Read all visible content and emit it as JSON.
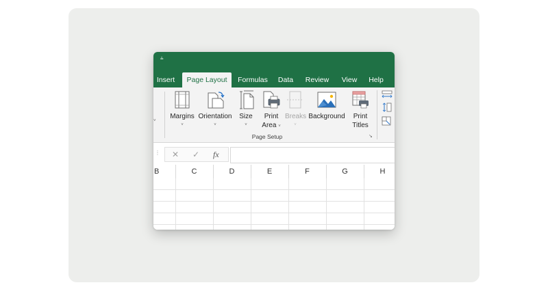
{
  "app": {
    "qat_icon": "customize-quick-access-icon",
    "qat_glyph": "⫨"
  },
  "tabs": [
    {
      "label": "Insert",
      "active": false
    },
    {
      "label": "Page Layout",
      "active": true
    },
    {
      "label": "Formulas",
      "active": false
    },
    {
      "label": "Data",
      "active": false
    },
    {
      "label": "Review",
      "active": false
    },
    {
      "label": "View",
      "active": false
    },
    {
      "label": "Help",
      "active": false
    }
  ],
  "ribbon": {
    "group_label": "Page Setup",
    "launcher_glyph": "↘",
    "buttons": {
      "margins": {
        "label": "Margins",
        "has_dropdown": true,
        "icon": "margins-icon"
      },
      "orientation": {
        "label": "Orientation",
        "has_dropdown": true,
        "icon": "orientation-icon"
      },
      "size": {
        "label": "Size",
        "has_dropdown": true,
        "icon": "size-icon"
      },
      "print_area": {
        "label_line1": "Print",
        "label_line2": "Area",
        "has_dropdown": true,
        "icon": "print-area-icon"
      },
      "breaks": {
        "label": "Breaks",
        "has_dropdown": true,
        "disabled": true,
        "icon": "breaks-icon"
      },
      "background": {
        "label": "Background",
        "icon": "background-icon"
      },
      "print_titles": {
        "label_line1": "Print",
        "label_line2": "Titles",
        "icon": "print-titles-icon"
      }
    },
    "dropdown_glyph": "˅",
    "chevron_glyph": "˅"
  },
  "formula_bar": {
    "cancel_glyph": "✕",
    "enter_glyph": "✓",
    "fx_label": "fx",
    "value": ""
  },
  "columns": [
    "B",
    "C",
    "D",
    "E",
    "F",
    "G",
    "H"
  ],
  "colors": {
    "brand_green": "#1f7145",
    "ribbon_bg": "#f3f3f3",
    "backdrop": "#edeeec"
  }
}
